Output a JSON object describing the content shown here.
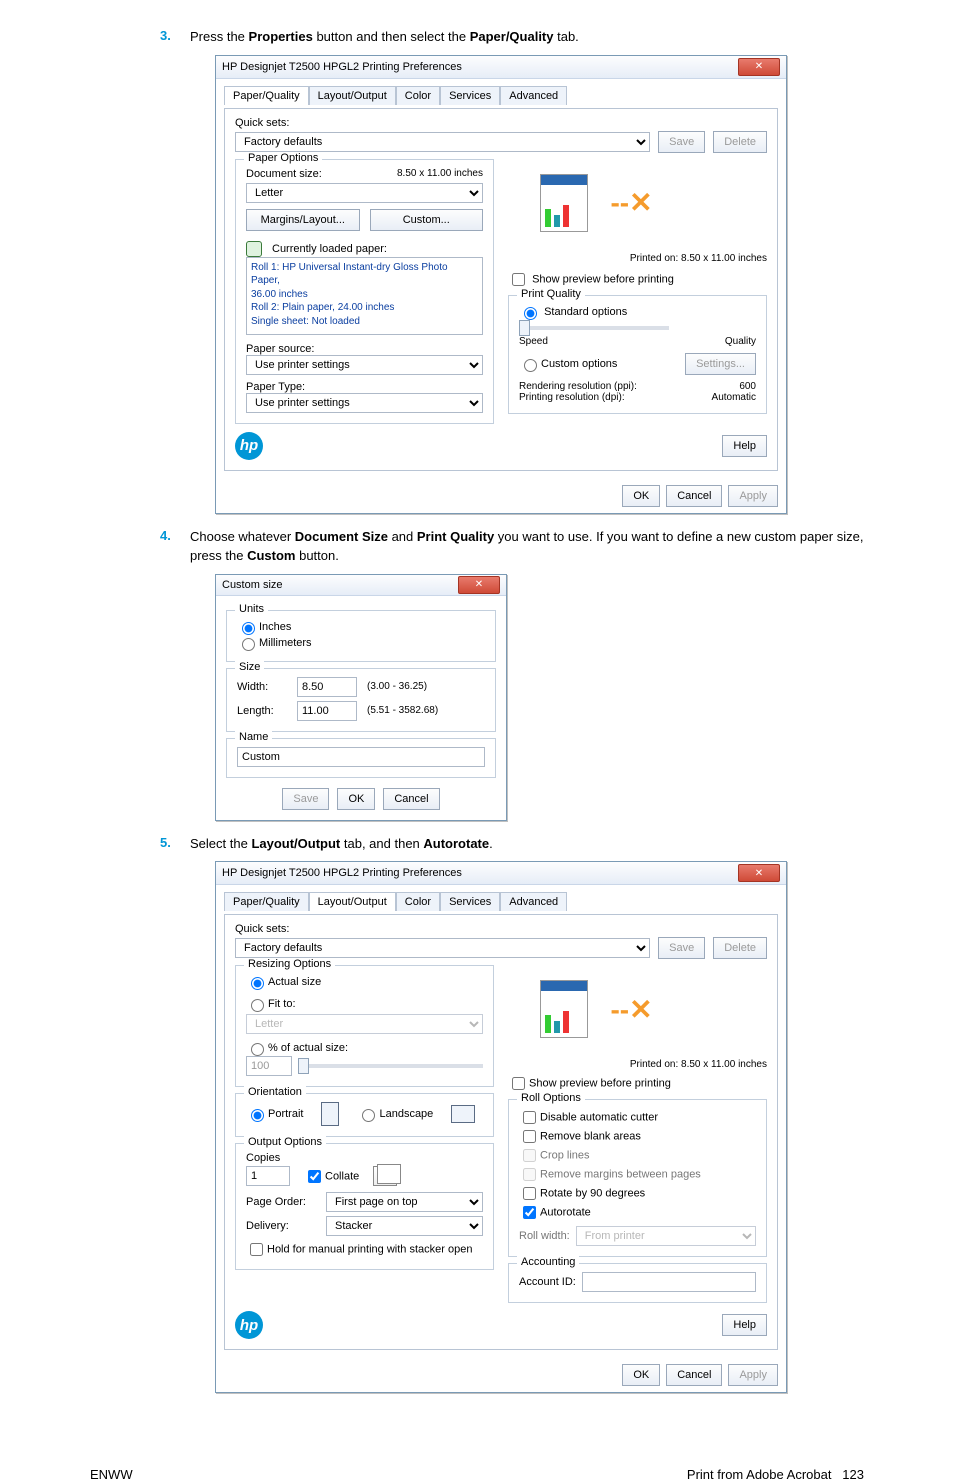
{
  "step3": {
    "num": "3.",
    "pre": "Press the ",
    "b1": "Properties",
    "mid": " button and then select the ",
    "b2": "Paper/Quality",
    "post": " tab."
  },
  "step4": {
    "num": "4.",
    "pre": "Choose whatever ",
    "b1": "Document Size",
    "mid1": " and ",
    "b2": "Print Quality",
    "mid2": " you want to use. If you want to define a new custom paper size, press the ",
    "b3": "Custom",
    "post": " button."
  },
  "step5": {
    "num": "5.",
    "pre": "Select the ",
    "b1": "Layout/Output",
    "mid": " tab, and then ",
    "b2": "Autorotate",
    "post": "."
  },
  "dlg1": {
    "title": "HP Designjet T2500 HPGL2 Printing Preferences",
    "tabs": [
      "Paper/Quality",
      "Layout/Output",
      "Color",
      "Services",
      "Advanced"
    ],
    "quicksets_label": "Quick sets:",
    "quicksets_value": "Factory defaults",
    "save": "Save",
    "delete": "Delete",
    "paper_options": "Paper Options",
    "doc_size_label": "Document size:",
    "doc_size_dims": "8.50 x 11.00 inches",
    "doc_size_value": "Letter",
    "margins_btn": "Margins/Layout...",
    "custom_btn": "Custom...",
    "loaded_paper": "Currently loaded paper:",
    "loaded_lines": [
      "Roll 1: HP Universal Instant-dry Gloss Photo Paper,",
      "36.00 inches",
      "Roll 2: Plain paper, 24.00 inches",
      "Single sheet: Not loaded"
    ],
    "paper_src_label": "Paper source:",
    "paper_src_value": "Use printer settings",
    "paper_type_label": "Paper Type:",
    "paper_type_value": "Use printer settings",
    "printed_on": "Printed on: 8.50 x 11.00 inches",
    "show_preview": "Show preview before printing",
    "print_quality": "Print Quality",
    "std_options": "Standard options",
    "speed": "Speed",
    "quality": "Quality",
    "custom_options": "Custom options",
    "settings": "Settings...",
    "rendering": "Rendering resolution (ppi):",
    "rendering_val": "600",
    "printing": "Printing resolution (dpi):",
    "printing_val": "Automatic",
    "help": "Help",
    "ok": "OK",
    "cancel": "Cancel",
    "apply": "Apply"
  },
  "dlg2": {
    "title": "Custom size",
    "units": "Units",
    "inches": "Inches",
    "mm": "Millimeters",
    "size": "Size",
    "width": "Width:",
    "width_val": "8.50",
    "width_range": "(3.00 - 36.25)",
    "length": "Length:",
    "length_val": "11.00",
    "length_range": "(5.51 - 3582.68)",
    "name": "Name",
    "name_val": "Custom",
    "save": "Save",
    "ok": "OK",
    "cancel": "Cancel"
  },
  "dlg3": {
    "title": "HP Designjet T2500 HPGL2 Printing Preferences",
    "tabs": [
      "Paper/Quality",
      "Layout/Output",
      "Color",
      "Services",
      "Advanced"
    ],
    "quicksets_label": "Quick sets:",
    "quicksets_value": "Factory defaults",
    "save": "Save",
    "delete": "Delete",
    "resizing": "Resizing Options",
    "actual_size": "Actual size",
    "fit_to": "Fit to:",
    "fit_to_value": "Letter",
    "pct_actual": "% of actual size:",
    "pct_val": "100",
    "orientation": "Orientation",
    "portrait": "Portrait",
    "landscape": "Landscape",
    "output": "Output Options",
    "copies": "Copies",
    "copies_val": "1",
    "collate": "Collate",
    "page_order": "Page Order:",
    "page_order_val": "First page on top",
    "delivery": "Delivery:",
    "delivery_val": "Stacker",
    "hold": "Hold for manual printing with stacker open",
    "printed_on": "Printed on: 8.50 x 11.00 inches",
    "show_preview": "Show preview before printing",
    "roll_options": "Roll Options",
    "disable_cutter": "Disable automatic cutter",
    "remove_blank": "Remove blank areas",
    "croplines": "Crop lines",
    "remove_margins": "Remove margins between pages",
    "rotate90": "Rotate by 90 degrees",
    "autorotate": "Autorotate",
    "roll_width": "Roll width:",
    "roll_width_val": "From printer",
    "accounting": "Accounting",
    "account_id": "Account ID:",
    "help": "Help",
    "ok": "OK",
    "cancel": "Cancel",
    "apply": "Apply"
  },
  "footer": {
    "left": "ENWW",
    "right_text": "Print from Adobe Acrobat",
    "right_page": "123"
  }
}
